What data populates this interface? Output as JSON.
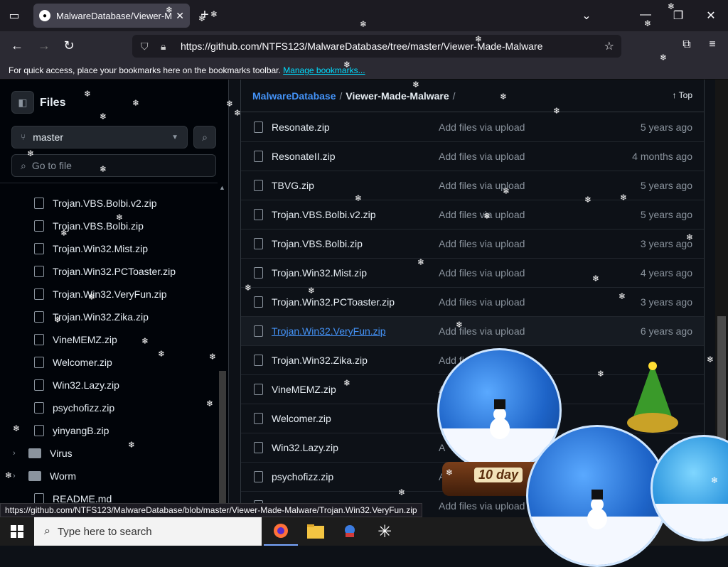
{
  "browser": {
    "tab_title": "MalwareDatabase/Viewer-Made",
    "url_host": "https://github.com/",
    "url_path": "NTFS123/MalwareDatabase/tree/master/Viewer-Made-Malware",
    "bookmarks_text": "For quick access, place your bookmarks here on the bookmarks toolbar.",
    "bookmarks_link": "Manage bookmarks..."
  },
  "sidebar": {
    "title": "Files",
    "branch": "master",
    "goto_placeholder": "Go to file",
    "items": [
      {
        "label": "Trojan.VBS.Bolbi.v2.zip",
        "type": "file"
      },
      {
        "label": "Trojan.VBS.Bolbi.zip",
        "type": "file"
      },
      {
        "label": "Trojan.Win32.Mist.zip",
        "type": "file"
      },
      {
        "label": "Trojan.Win32.PCToaster.zip",
        "type": "file"
      },
      {
        "label": "Trojan.Win32.VeryFun.zip",
        "type": "file"
      },
      {
        "label": "Trojan.Win32.Zika.zip",
        "type": "file"
      },
      {
        "label": "VineMEMZ.zip",
        "type": "file"
      },
      {
        "label": "Welcomer.zip",
        "type": "file"
      },
      {
        "label": "Win32.Lazy.zip",
        "type": "file"
      },
      {
        "label": "psychofizz.zip",
        "type": "file"
      },
      {
        "label": "yinyangB.zip",
        "type": "file"
      },
      {
        "label": "Virus",
        "type": "folder"
      },
      {
        "label": "Worm",
        "type": "folder"
      },
      {
        "label": "README.md",
        "type": "file"
      }
    ]
  },
  "breadcrumb": {
    "repo": "MalwareDatabase",
    "sep": "/",
    "folder": "Viewer-Made-Malware",
    "trail": "/",
    "top_label": "Top"
  },
  "files": [
    {
      "name": "Resonate.zip",
      "message": "Add files via upload",
      "age": "5 years ago"
    },
    {
      "name": "ResonateII.zip",
      "message": "Add files via upload",
      "age": "4 months ago"
    },
    {
      "name": "TBVG.zip",
      "message": "Add files via upload",
      "age": "5 years ago"
    },
    {
      "name": "Trojan.VBS.Bolbi.v2.zip",
      "message": "Add files via upload",
      "age": "5 years ago"
    },
    {
      "name": "Trojan.VBS.Bolbi.zip",
      "message": "Add files via upload",
      "age": "3 years ago"
    },
    {
      "name": "Trojan.Win32.Mist.zip",
      "message": "Add files via upload",
      "age": "4 years ago"
    },
    {
      "name": "Trojan.Win32.PCToaster.zip",
      "message": "Add files via upload",
      "age": "3 years ago"
    },
    {
      "name": "Trojan.Win32.VeryFun.zip",
      "message": "Add files via upload",
      "age": "6 years ago"
    },
    {
      "name": "Trojan.Win32.Zika.zip",
      "message": "Add fi",
      "age": ""
    },
    {
      "name": "VineMEMZ.zip",
      "message": "A",
      "age": ""
    },
    {
      "name": "Welcomer.zip",
      "message": "",
      "age": ""
    },
    {
      "name": "Win32.Lazy.zip",
      "message": "A",
      "age": ""
    },
    {
      "name": "psychofizz.zip",
      "message": "A",
      "age": ""
    },
    {
      "name": "",
      "message": "Add files via upload",
      "age": ""
    }
  ],
  "status_url": "https://github.com/NTFS123/MalwareDatabase/blob/master/Viewer-Made-Malware/Trojan.Win32.VeryFun.zip",
  "taskbar": {
    "search_placeholder": "Type here to search"
  },
  "overlay": {
    "globe_label": "10 day"
  }
}
